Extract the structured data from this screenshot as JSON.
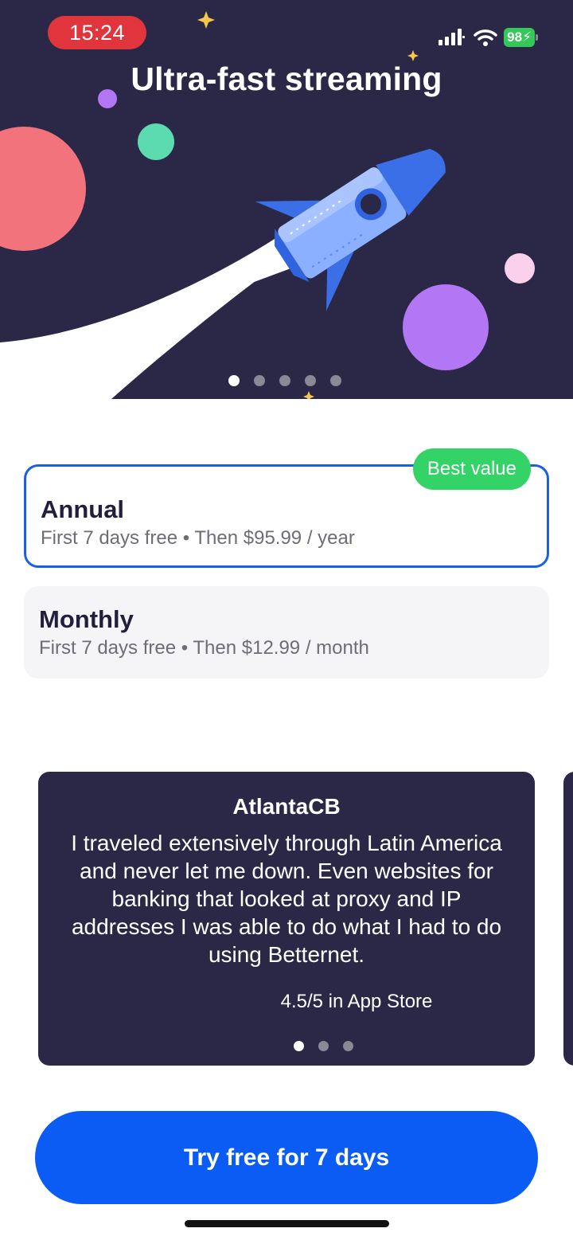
{
  "status_bar": {
    "time": "15:24",
    "battery": "98"
  },
  "hero": {
    "title": "Ultra-fast streaming",
    "illustration": "rocket-launch-in-space",
    "carousel_pages": 5,
    "carousel_active": 1
  },
  "plans": [
    {
      "name": "Annual",
      "trial": "First 7 days free",
      "separator": "•",
      "price": "Then $95.99 / year",
      "badge": "Best value",
      "selected": true
    },
    {
      "name": "Monthly",
      "trial": "First 7 days free",
      "separator": "•",
      "price": "Then $12.99 / month",
      "selected": false
    }
  ],
  "review": {
    "author": "AtlantaCB",
    "text": "I traveled extensively through Latin America and never let me down. Even websites for banking that looked at proxy and IP addresses I was able to do what I had to do using Betternet.",
    "rating": "4.5/5 in App Store",
    "carousel_pages": 3,
    "carousel_active": 1
  },
  "cta": {
    "label": "Try free for 7 days"
  },
  "colors": {
    "hero_bg": "#2b2746",
    "accent_blue": "#0a5cf5",
    "selected_border": "#1c5ee6",
    "badge_green": "#34d367",
    "time_pill_red": "#e0353d"
  }
}
